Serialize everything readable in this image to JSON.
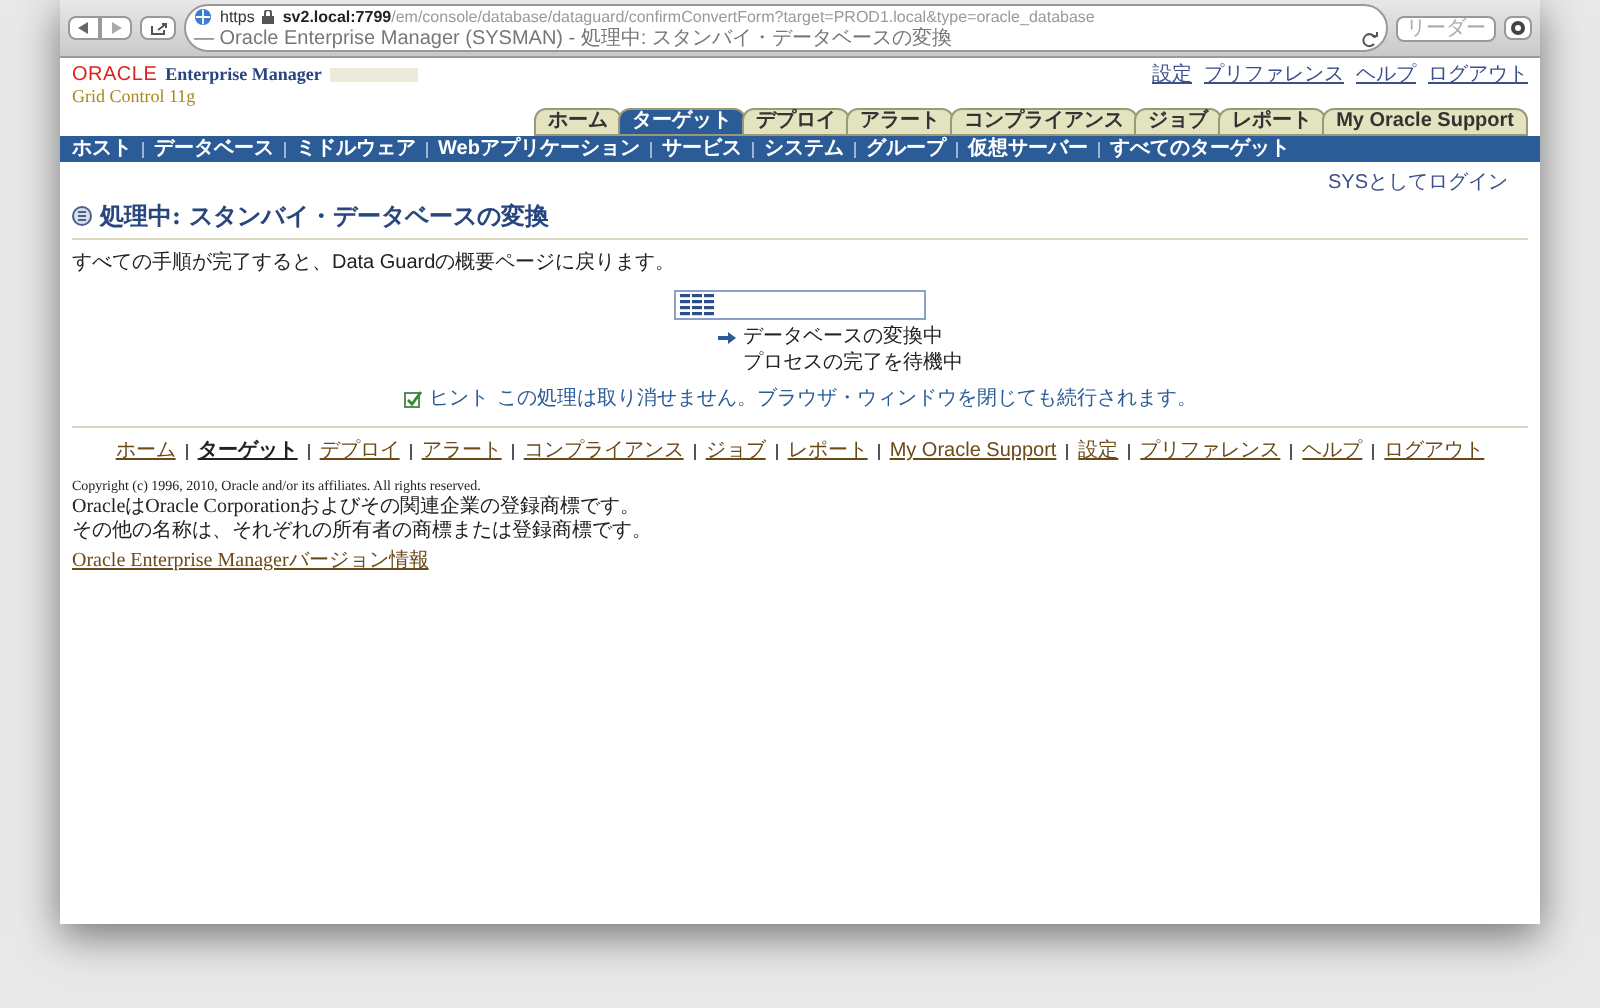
{
  "browser": {
    "protocol": "https",
    "url_host": "sv2.local:7799",
    "url_path": "/em/console/database/dataguard/confirmConvertForm?target=PROD1.local&type=oracle_database",
    "page_title": "— Oracle Enterprise Manager (SYSMAN) - 処理中: スタンバイ・データベースの変換",
    "reader_button": "リーダー"
  },
  "header": {
    "brand": "ORACLE",
    "product": "Enterprise Manager",
    "edition": "Grid Control 11g",
    "global_links": [
      "設定",
      "プリファレンス",
      "ヘルプ",
      "ログアウト"
    ],
    "tabs": [
      {
        "label": "ホーム",
        "selected": false
      },
      {
        "label": "ターゲット",
        "selected": true
      },
      {
        "label": "デプロイ",
        "selected": false
      },
      {
        "label": "アラート",
        "selected": false
      },
      {
        "label": "コンプライアンス",
        "selected": false
      },
      {
        "label": "ジョブ",
        "selected": false
      },
      {
        "label": "レポート",
        "selected": false
      },
      {
        "label": "My Oracle Support",
        "selected": false
      }
    ],
    "subtabs": [
      "ホスト",
      "データベース",
      "ミドルウェア",
      "Webアプリケーション",
      "サービス",
      "システム",
      "グループ",
      "仮想サーバー",
      "すべてのターゲット"
    ]
  },
  "login_as": "SYSとしてログイン",
  "page": {
    "title": "処理中: スタンバイ・データベースの変換",
    "intro": "すべての手順が完了すると、Data Guardの概要ページに戻ります。",
    "steps": [
      "データベースの変換中",
      "プロセスの完了を待機中"
    ],
    "hint_label": "ヒント",
    "hint": "この処理は取り消せません。ブラウザ・ウィンドウを閉じても続行されます。"
  },
  "footer": {
    "links": [
      {
        "label": "ホーム",
        "selected": false
      },
      {
        "label": "ターゲット",
        "selected": true
      },
      {
        "label": "デプロイ",
        "selected": false
      },
      {
        "label": "アラート",
        "selected": false
      },
      {
        "label": "コンプライアンス",
        "selected": false
      },
      {
        "label": "ジョブ",
        "selected": false
      },
      {
        "label": "レポート",
        "selected": false
      },
      {
        "label": "My Oracle Support",
        "selected": false
      },
      {
        "label": "設定",
        "selected": false
      },
      {
        "label": "プリファレンス",
        "selected": false
      },
      {
        "label": "ヘルプ",
        "selected": false
      },
      {
        "label": "ログアウト",
        "selected": false
      }
    ],
    "copyright": [
      "Copyright (c) 1996, 2010, Oracle and/or its affiliates. All rights reserved.",
      "OracleはOracle Corporationおよびその関連企業の登録商標です。",
      "その他の名称は、それぞれの所有者の商標または登録商標です。"
    ],
    "about_link": "Oracle Enterprise Managerバージョン情報"
  }
}
